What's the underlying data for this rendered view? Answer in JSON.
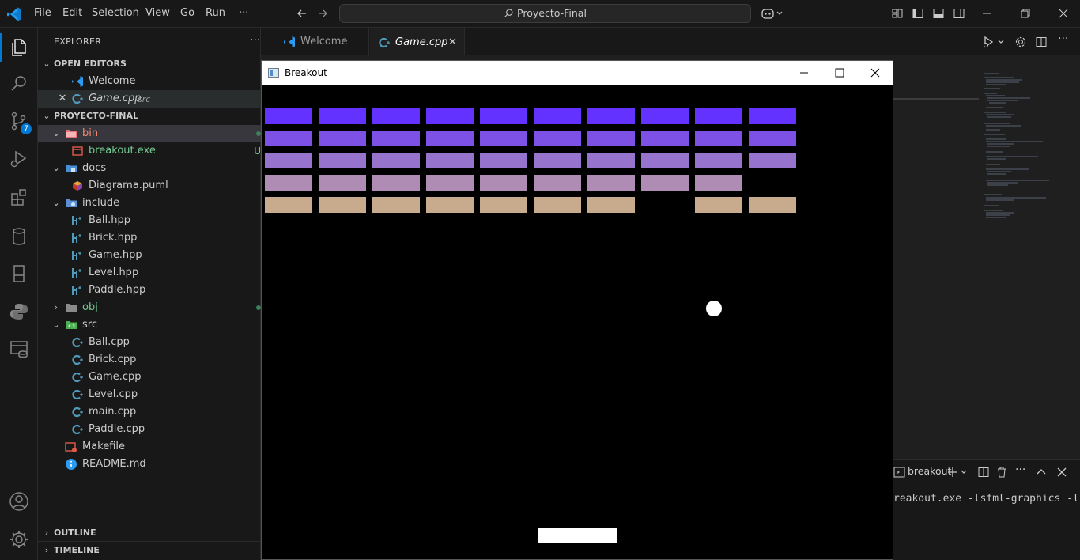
{
  "titlebar": {
    "menus": [
      "File",
      "Edit",
      "Selection",
      "View",
      "Go",
      "Run",
      "···"
    ],
    "search_text": "Proyecto-Final"
  },
  "activitybar": {
    "scm_badge": "7",
    "icons": [
      "files-icon",
      "search-icon",
      "source-control-icon",
      "run-debug-icon",
      "extensions-icon",
      "database-icon",
      "remote-icon",
      "python-icon",
      "layers-icon",
      "account-icon",
      "settings-gear-icon"
    ]
  },
  "sidebar": {
    "title": "EXPLORER",
    "open_editors_header": "OPEN EDITORS",
    "open_editors": [
      {
        "name": "Welcome"
      },
      {
        "name": "Game.cpp",
        "hint": "src"
      }
    ],
    "project_header": "PROYECTO-FINAL",
    "tree": {
      "bin": "bin",
      "breakout_exe": "breakout.exe",
      "breakout_badge": "U",
      "docs": "docs",
      "diagrama": "Diagrama.puml",
      "include": "include",
      "ball_hpp": "Ball.hpp",
      "brick_hpp": "Brick.hpp",
      "game_hpp": "Game.hpp",
      "level_hpp": "Level.hpp",
      "paddle_hpp": "Paddle.hpp",
      "obj": "obj",
      "src": "src",
      "ball_cpp": "Ball.cpp",
      "brick_cpp": "Brick.cpp",
      "game_cpp": "Game.cpp",
      "level_cpp": "Level.cpp",
      "main_cpp": "main.cpp",
      "paddle_cpp": "Paddle.cpp",
      "makefile": "Makefile",
      "readme": "README.md"
    },
    "outline_header": "OUTLINE",
    "timeline_header": "TIMELINE"
  },
  "tabs": [
    {
      "label": "Welcome"
    },
    {
      "label": "Game.cpp"
    }
  ],
  "panel": {
    "terminal_name": "breakout",
    "terminal_line": "reakout.exe -lsfml-graphics -ls"
  },
  "game": {
    "window_title": "Breakout",
    "row_colors": [
      "#6432ff",
      "#7d50e6",
      "#9673cd",
      "#af8cb4",
      "#c8aa8c"
    ],
    "grid_rows": 5,
    "grid_cols": 10,
    "missing_bricks": [
      [
        3,
        9
      ],
      [
        4,
        7
      ]
    ],
    "ball_color": "#ffffff",
    "paddle_color": "#ffffff"
  }
}
